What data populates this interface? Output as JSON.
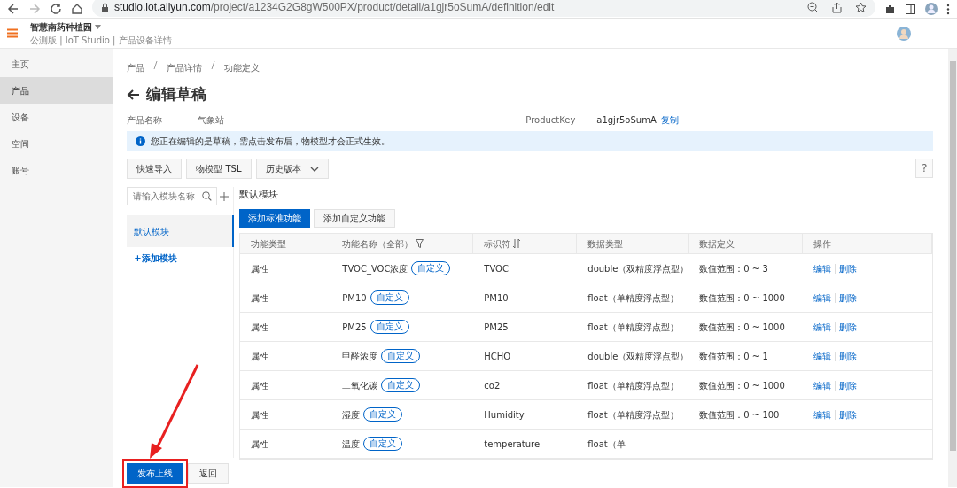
{
  "browser": {
    "url_host": "studio.iot.aliyun.com",
    "url_path": "/project/a1234G2G8gW500PX/product/detail/a1gjr5oSumA/definition/edit"
  },
  "header": {
    "title": "智慧南药种植园",
    "subtitle": "公测版 | IoT Studio | 产品设备详情"
  },
  "sidebar": {
    "items": [
      {
        "label": "主页",
        "selected": false
      },
      {
        "label": "产品",
        "selected": true
      },
      {
        "label": "设备",
        "selected": false
      },
      {
        "label": "空间",
        "selected": false
      },
      {
        "label": "账号",
        "selected": false
      }
    ]
  },
  "breadcrumb": [
    "产品",
    "产品详情",
    "功能定义"
  ],
  "page_title": "编辑草稿",
  "product_info": {
    "name_label": "产品名称",
    "name_value": "气象站",
    "key_label": "ProductKey",
    "key_value": "a1gjr5oSumA",
    "copy_link": "复制"
  },
  "alert": "您正在编辑的是草稿，需点击发布后，物模型才会正式生效。",
  "toolbar": [
    {
      "label": "快速导入",
      "kind": "plain"
    },
    {
      "label": "物模型 TSL",
      "kind": "plain"
    },
    {
      "label": "历史版本",
      "kind": "dropdown"
    }
  ],
  "module_search": {
    "placeholder": "请输入模块名称"
  },
  "modules": [
    {
      "label": "默认模块",
      "selected": true
    }
  ],
  "add_module": "+添加模块",
  "module_title": "默认模块",
  "module_buttons": [
    {
      "label": "添加标准功能",
      "kind": "primary"
    },
    {
      "label": "添加自定义功能",
      "kind": "secondary"
    }
  ],
  "table": {
    "columns": [
      {
        "label": "功能类型",
        "kind": "plain"
      },
      {
        "label": "功能名称（全部）",
        "kind": "filter"
      },
      {
        "label": "标识符",
        "kind": "sort"
      },
      {
        "label": "数据类型",
        "kind": "plain"
      },
      {
        "label": "数据定义",
        "kind": "plain"
      },
      {
        "label": "操作",
        "kind": "plain"
      }
    ],
    "rows": [
      {
        "type": "属性",
        "name": "TVOC_VOC浓度",
        "tag": "自定义",
        "identifier": "TVOC",
        "data_type": "double（双精度浮点型）",
        "definition": "数值范围：0 ~ 3",
        "actions": [
          "编辑",
          "删除"
        ]
      },
      {
        "type": "属性",
        "name": "PM10",
        "tag": "自定义",
        "identifier": "PM10",
        "data_type": "float（单精度浮点型）",
        "definition": "数值范围：0 ~ 1000",
        "actions": [
          "编辑",
          "删除"
        ]
      },
      {
        "type": "属性",
        "name": "PM25",
        "tag": "自定义",
        "identifier": "PM25",
        "data_type": "float（单精度浮点型）",
        "definition": "数值范围：0 ~ 1000",
        "actions": [
          "编辑",
          "删除"
        ]
      },
      {
        "type": "属性",
        "name": "甲醛浓度",
        "tag": "自定义",
        "identifier": "HCHO",
        "data_type": "double（双精度浮点型）",
        "definition": "数值范围：0 ~ 1",
        "actions": [
          "编辑",
          "删除"
        ]
      },
      {
        "type": "属性",
        "name": "二氧化碳",
        "tag": "自定义",
        "identifier": "co2",
        "data_type": "float（单精度浮点型）",
        "definition": "数值范围：0 ~ 1000",
        "actions": [
          "编辑",
          "删除"
        ]
      },
      {
        "type": "属性",
        "name": "湿度",
        "tag": "自定义",
        "identifier": "Humidity",
        "data_type": "float（单精度浮点型）",
        "definition": "数值范围：0 ~ 100",
        "actions": [
          "编辑",
          "删除"
        ]
      },
      {
        "type": "属性",
        "name": "温度",
        "tag": "自定义",
        "identifier": "temperature",
        "data_type": "float（单"
      }
    ]
  },
  "footer_buttons": [
    {
      "label": "发布上线",
      "kind": "primary",
      "highlighted": true
    },
    {
      "label": "返回",
      "kind": "secondary",
      "highlighted": false
    }
  ],
  "help": "?"
}
